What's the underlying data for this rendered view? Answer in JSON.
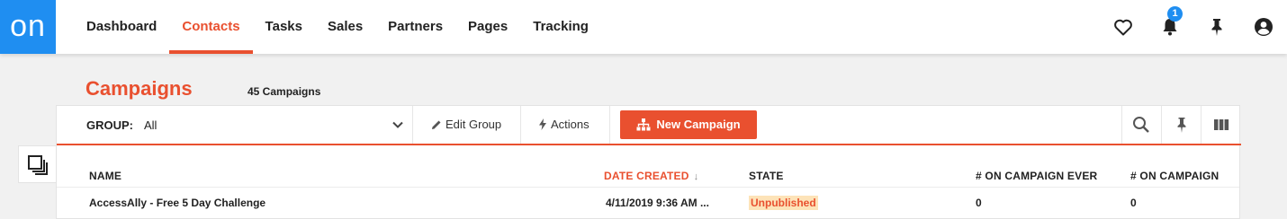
{
  "app": {
    "logo_text": "on"
  },
  "nav": {
    "items": [
      {
        "label": "Dashboard",
        "active": false
      },
      {
        "label": "Contacts",
        "active": true
      },
      {
        "label": "Tasks",
        "active": false
      },
      {
        "label": "Sales",
        "active": false
      },
      {
        "label": "Partners",
        "active": false
      },
      {
        "label": "Pages",
        "active": false
      },
      {
        "label": "Tracking",
        "active": false
      }
    ],
    "right_icons": [
      "heart-icon",
      "bell-icon",
      "pin-icon",
      "account-icon"
    ],
    "notification_count": "1"
  },
  "page": {
    "title": "Campaigns",
    "count_label": "45 Campaigns"
  },
  "toolbar": {
    "group_label": "GROUP:",
    "group_value": "All",
    "edit_group_label": "Edit Group",
    "actions_label": "Actions",
    "new_campaign_label": "New Campaign",
    "right_icons": [
      "search-icon",
      "pin-icon",
      "columns-icon"
    ]
  },
  "table": {
    "columns": [
      "NAME",
      "DATE CREATED",
      "STATE",
      "# ON CAMPAIGN EVER",
      "# ON CAMPAIGN"
    ],
    "sorted_column": "DATE CREATED",
    "sort_indicator": "↓",
    "rows": [
      {
        "name": "AccessAlly - Free 5 Day Challenge",
        "date_created": "4/11/2019 9:36 AM ...",
        "state": "Unpublished",
        "on_campaign_ever": "0",
        "on_campaign": "0"
      }
    ]
  },
  "colors": {
    "accent": "#e9502f",
    "brand_blue": "#1f8ef1",
    "state_badge_bg": "#fde3b8"
  }
}
